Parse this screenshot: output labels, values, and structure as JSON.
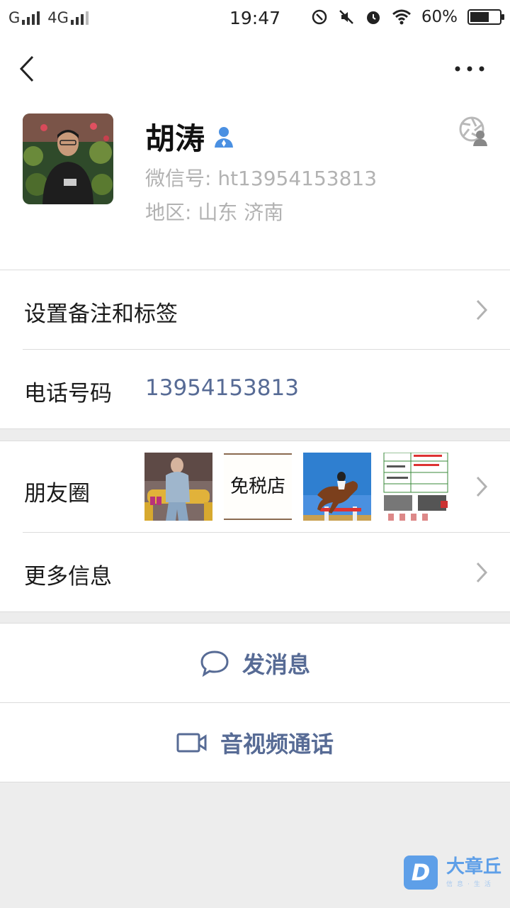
{
  "status_bar": {
    "carrier1": "G",
    "carrier2": "4G",
    "time": "19:47",
    "battery": "60%"
  },
  "nav": {
    "back_icon": "back-chevron-icon",
    "more_icon": "more-dots-icon"
  },
  "profile": {
    "name": "胡涛",
    "wechat_id": "微信号: ht13954153813",
    "region": "地区: 山东  济南"
  },
  "rows": {
    "remark_label": "设置备注和标签",
    "phone_label": "电话号码",
    "phone_value": "13954153813",
    "moments_label": "朋友圈",
    "moments_thumb_text": "免税店",
    "more_label": "更多信息"
  },
  "actions": {
    "message": "发消息",
    "call": "音视频通话"
  },
  "watermark": {
    "text": "大章丘",
    "sub": "信息·生活"
  },
  "colors": {
    "link": "#576b95",
    "background": "#ededed",
    "watermark": "#5e9fe8"
  }
}
